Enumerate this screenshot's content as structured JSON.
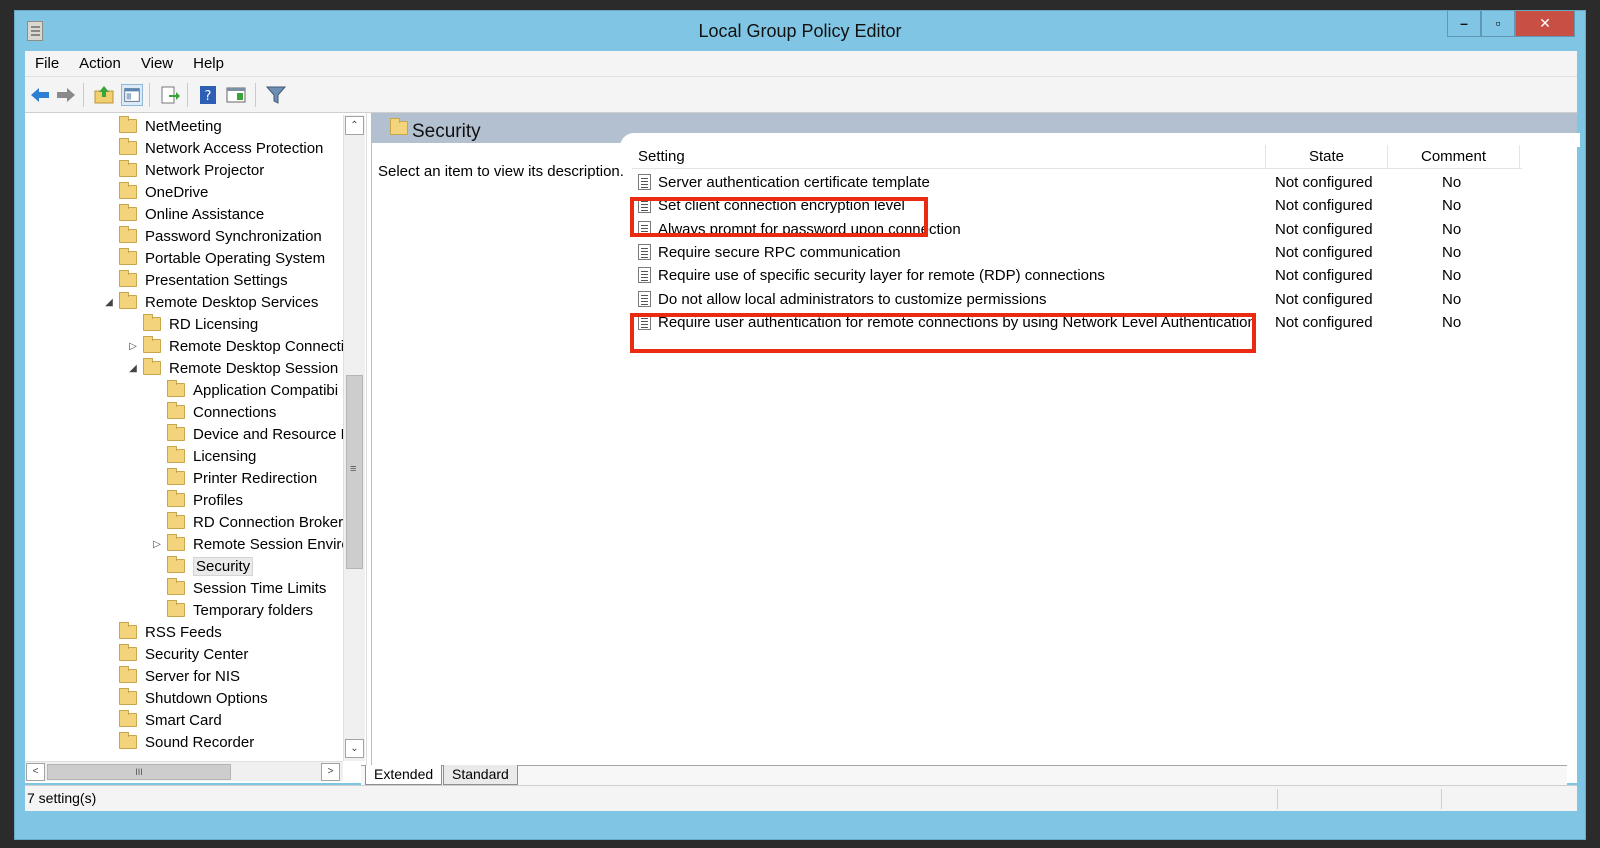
{
  "window": {
    "title": "Local Group Policy Editor",
    "controls": {
      "minimize": "–",
      "maximize": "▫",
      "close": "✕"
    }
  },
  "menu": [
    "File",
    "Action",
    "View",
    "Help"
  ],
  "toolbar": {
    "icons": [
      "back-arrow-icon",
      "forward-arrow-icon",
      "up-folder-icon",
      "show-hide-tree-icon",
      "export-list-icon",
      "help-icon",
      "properties-icon",
      "filter-icon"
    ]
  },
  "tree": {
    "items": [
      {
        "label": "NetMeeting",
        "level": 0,
        "expander": ""
      },
      {
        "label": "Network Access Protection",
        "level": 0,
        "expander": ""
      },
      {
        "label": "Network Projector",
        "level": 0,
        "expander": ""
      },
      {
        "label": "OneDrive",
        "level": 0,
        "expander": ""
      },
      {
        "label": "Online Assistance",
        "level": 0,
        "expander": ""
      },
      {
        "label": "Password Synchronization",
        "level": 0,
        "expander": ""
      },
      {
        "label": "Portable Operating System",
        "level": 0,
        "expander": ""
      },
      {
        "label": "Presentation Settings",
        "level": 0,
        "expander": ""
      },
      {
        "label": "Remote Desktop Services",
        "level": 0,
        "expander": "◢"
      },
      {
        "label": "RD Licensing",
        "level": 1,
        "expander": ""
      },
      {
        "label": "Remote Desktop Connecti",
        "level": 1,
        "expander": "▷"
      },
      {
        "label": "Remote Desktop Session H",
        "level": 1,
        "expander": "◢"
      },
      {
        "label": "Application Compatibi",
        "level": 2,
        "expander": ""
      },
      {
        "label": "Connections",
        "level": 2,
        "expander": ""
      },
      {
        "label": "Device and Resource R",
        "level": 2,
        "expander": ""
      },
      {
        "label": "Licensing",
        "level": 2,
        "expander": ""
      },
      {
        "label": "Printer Redirection",
        "level": 2,
        "expander": ""
      },
      {
        "label": "Profiles",
        "level": 2,
        "expander": ""
      },
      {
        "label": "RD Connection Broker",
        "level": 2,
        "expander": ""
      },
      {
        "label": "Remote Session Enviror",
        "level": 2,
        "expander": "▷"
      },
      {
        "label": "Security",
        "level": 2,
        "expander": "",
        "selected": true
      },
      {
        "label": "Session Time Limits",
        "level": 2,
        "expander": ""
      },
      {
        "label": "Temporary folders",
        "level": 2,
        "expander": ""
      },
      {
        "label": "RSS Feeds",
        "level": 0,
        "expander": ""
      },
      {
        "label": "Security Center",
        "level": 0,
        "expander": ""
      },
      {
        "label": "Server for NIS",
        "level": 0,
        "expander": ""
      },
      {
        "label": "Shutdown Options",
        "level": 0,
        "expander": ""
      },
      {
        "label": "Smart Card",
        "level": 0,
        "expander": ""
      },
      {
        "label": "Sound Recorder",
        "level": 0,
        "expander": ""
      }
    ],
    "scroll": {
      "up": "⌃",
      "down": "⌄",
      "left": "<",
      "right": ">",
      "grip": "≡",
      "hgrip": "III"
    }
  },
  "details": {
    "header_title": "Security",
    "description": "Select an item to view its description.",
    "columns": {
      "setting": "Setting",
      "state": "State",
      "comment": "Comment"
    },
    "rows": [
      {
        "setting": "Server authentication certificate template",
        "state": "Not configured",
        "comment": "No"
      },
      {
        "setting": "Set client connection encryption level",
        "state": "Not configured",
        "comment": "No"
      },
      {
        "setting": "Always prompt for password upon connection",
        "state": "Not configured",
        "comment": "No"
      },
      {
        "setting": "Require secure RPC communication",
        "state": "Not configured",
        "comment": "No"
      },
      {
        "setting": "Require use of specific security layer for remote (RDP) connections",
        "state": "Not configured",
        "comment": "No"
      },
      {
        "setting": "Do not allow local administrators to customize permissions",
        "state": "Not configured",
        "comment": "No"
      },
      {
        "setting": "Require user authentication for remote connections by using Network Level Authentication",
        "state": "Not configured",
        "comment": "No"
      }
    ],
    "highlight_color": "#ea2a11"
  },
  "tabs": [
    "Extended",
    "Standard"
  ],
  "status": {
    "text": "7 setting(s)"
  }
}
